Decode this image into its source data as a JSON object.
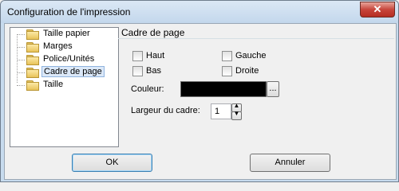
{
  "window": {
    "title": "Configuration de l'impression",
    "close_glyph": "✕"
  },
  "tree": {
    "items": [
      {
        "label": "Taille papier",
        "icon": "folder-icon"
      },
      {
        "label": "Marges",
        "icon": "folder-icon"
      },
      {
        "label": "Police/Unités",
        "icon": "folder-icon"
      },
      {
        "label": "Cadre de page",
        "icon": "folder-icon",
        "selected": true
      },
      {
        "label": "Taille",
        "icon": "folder-icon"
      }
    ]
  },
  "panel": {
    "title": "Cadre de page",
    "checkboxes": {
      "haut": {
        "label": "Haut",
        "checked": false
      },
      "gauche": {
        "label": "Gauche",
        "checked": false
      },
      "bas": {
        "label": "Bas",
        "checked": false
      },
      "droite": {
        "label": "Droite",
        "checked": false
      }
    },
    "couleur": {
      "label": "Couleur:",
      "value_color": "#000000",
      "browse_label": "..."
    },
    "largeur": {
      "label": "Largeur du cadre:",
      "value": "1",
      "up_glyph": "▲",
      "down_glyph": "▼"
    }
  },
  "buttons": {
    "ok": "OK",
    "annuler": "Annuler"
  }
}
